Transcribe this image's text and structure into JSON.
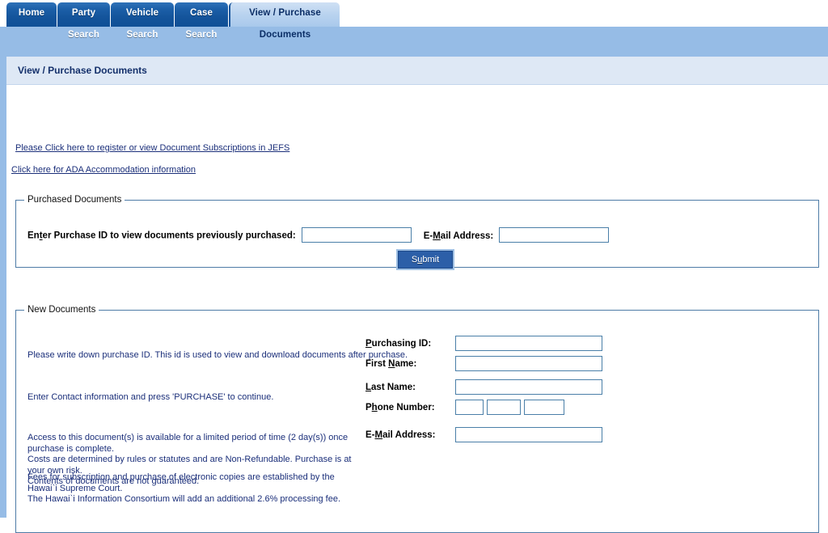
{
  "tabs": [
    {
      "label": "Home",
      "active": false
    },
    {
      "label": "Party Search",
      "active": false
    },
    {
      "label": "Vehicle Search",
      "active": false
    },
    {
      "label": "Case Search",
      "active": false
    },
    {
      "label": "View / Purchase Documents",
      "active": true
    }
  ],
  "panel": {
    "title": "View / Purchase Documents"
  },
  "links": {
    "jefs": "Please Click here to register or view Document Subscriptions in JEFS",
    "ada": "Click here for ADA Accommodation information"
  },
  "purchased": {
    "legend": "Purchased Documents",
    "purchase_id_label_pre": "En",
    "purchase_id_label_key": "t",
    "purchase_id_label_post": "er Purchase ID to view documents previously purchased:",
    "purchase_id_value": "",
    "email_label_pre": "E-",
    "email_label_key": "M",
    "email_label_post": "ail Address:",
    "email_value": "",
    "submit_pre": "S",
    "submit_key": "u",
    "submit_post": "bmit"
  },
  "new_documents": {
    "legend": "New Documents",
    "paragraphs": {
      "p1": "Please write down purchase ID. This id is used to view and download documents after purchase.",
      "p2": "Enter Contact information and press 'PURCHASE' to continue.",
      "p3_line1": "Access to this document(s) is available for a limited period of time (2 day(s)) once purchase is complete.",
      "p3_line2": "Costs are determined by rules or statutes and are Non-Refundable. Purchase is at your own risk.",
      "p3_line3": "Contents of documents are not guaranteed.",
      "p4_line1": "Fees for subscription and purchase of electronic copies are established by the Hawai`i Supreme Court.",
      "p4_line2": "The Hawai`i Information Consortium will add an additional 2.6% processing fee."
    },
    "fields": {
      "purchasing_id": {
        "label_pre": "",
        "label_key": "P",
        "label_post": "urchasing ID:",
        "value": ""
      },
      "first_name": {
        "label_pre": "First ",
        "label_key": "N",
        "label_post": "ame:",
        "value": ""
      },
      "last_name": {
        "label_pre": "",
        "label_key": "L",
        "label_post": "ast Name:",
        "value": ""
      },
      "phone_number": {
        "label_pre": "P",
        "label_key": "h",
        "label_post": "one Number:",
        "area_value": "",
        "prefix_value": "",
        "line_value": ""
      },
      "email_address": {
        "label_pre": "E-",
        "label_key": "M",
        "label_post": "ail Address:",
        "value": ""
      }
    }
  },
  "colors": {
    "tab_active_text": "#0b2e66",
    "tab_inactive_bg": "#14549b",
    "page_band": "#96bce6",
    "panel_header": "#dee8f5",
    "link": "#1b2f7a",
    "fieldset_border": "#4e7ba6",
    "input_border": "#4a7fa8",
    "button_bg": "#2c5fa8",
    "body_text": "#1b2f7a"
  }
}
